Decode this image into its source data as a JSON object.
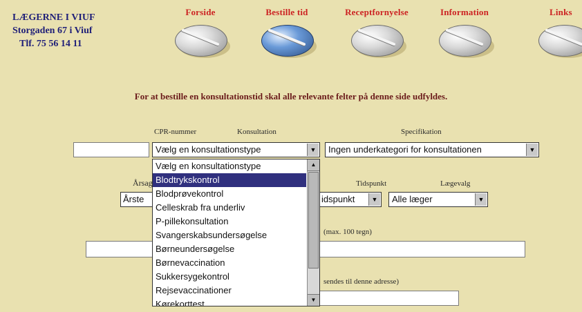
{
  "clinic": {
    "name": "LÆGERNE I VIUF",
    "address": "Storgaden 67 i Viuf",
    "phone": "Tlf. 75 56 14 11"
  },
  "nav": [
    {
      "label": "Forside",
      "icon": "pill-icon"
    },
    {
      "label": "Bestille tid",
      "icon": "pill-icon"
    },
    {
      "label": "Receptfornyelse",
      "icon": "pill-icon"
    },
    {
      "label": "Information",
      "icon": "pill-icon"
    },
    {
      "label": "Links",
      "icon": "pill-icon"
    }
  ],
  "instruction": "For at bestille en konsultationstid skal alle relevante felter på denne side udfyldes.",
  "labels": {
    "cpr": "CPR-nummer",
    "konsultation": "Konsultation",
    "specifikation": "Specifikation",
    "aarsag_fragment": "Årsag",
    "tidspunkt": "Tidspunkt",
    "laegevalg": "Lægevalg",
    "comment_fragment": "(max. 100 tegn)",
    "email_fragment": "sendes til denne adresse)"
  },
  "fields": {
    "cpr_value": "",
    "konsultation_selected": "Vælg en konsultationstype",
    "specifikation_selected": "Ingen underkategori for konsultationen",
    "aarsag_fragment": "Årste",
    "tidspunkt_fragment": "idspunkt",
    "laegevalg_selected": "Alle læger"
  },
  "konsultation_options": [
    "Vælg en konsultationstype",
    "Blodtrykskontrol",
    "Blodprøvekontrol",
    "Celleskrab fra underliv",
    "P-pillekonsultation",
    "Svangerskabsundersøgelse",
    "Børneundersøgelse",
    "Børnevaccination",
    "Sukkersygekontrol",
    "Rejsevaccinationer",
    "Kørekorttest"
  ],
  "highlighted_option_index": 1,
  "colors": {
    "accent_red": "#cc2222",
    "clinic_blue": "#1f1f78",
    "highlight": "#30307e",
    "background": "#e9e1b0"
  }
}
